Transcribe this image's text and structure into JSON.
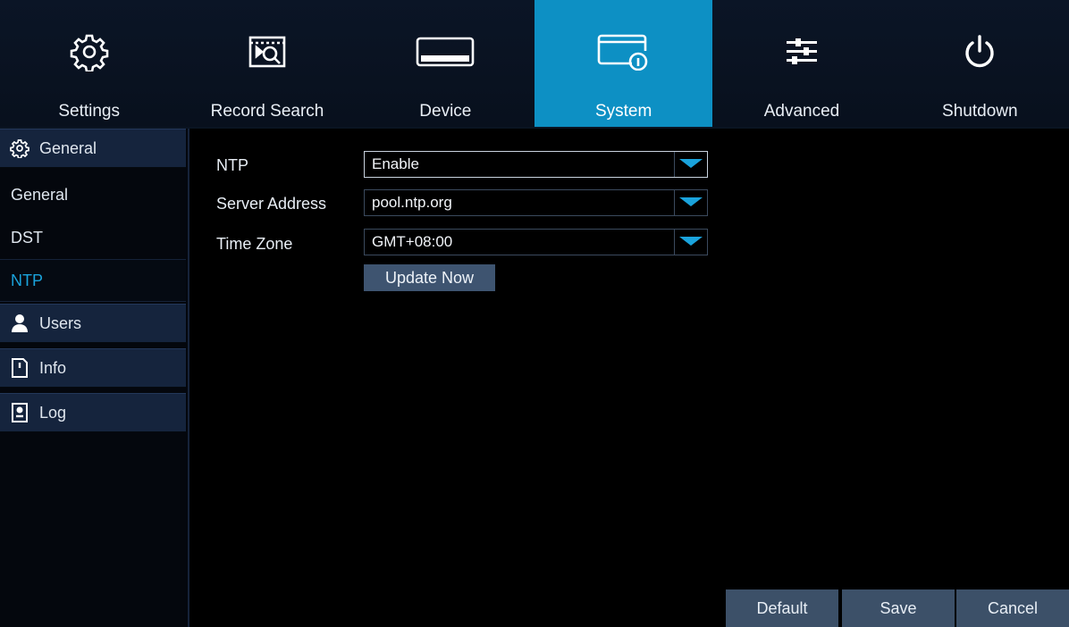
{
  "nav": {
    "tabs": [
      {
        "label": "Settings",
        "icon": "gear-icon"
      },
      {
        "label": "Record Search",
        "icon": "record-search-icon"
      },
      {
        "label": "Device",
        "icon": "hard-drive-icon"
      },
      {
        "label": "System",
        "icon": "system-info-icon"
      },
      {
        "label": "Advanced",
        "icon": "sliders-icon"
      },
      {
        "label": "Shutdown",
        "icon": "power-icon"
      }
    ],
    "active_tab": "System",
    "accent_color": "#0d90c4"
  },
  "sidebar": {
    "general_group": "General",
    "sub_items": [
      "General",
      "DST",
      "NTP"
    ],
    "active_sub": "NTP",
    "users_group": "Users",
    "info_group": "Info",
    "log_group": "Log"
  },
  "form": {
    "ntp_label": "NTP",
    "ntp_value": "Enable",
    "server_label": "Server Address",
    "server_value": "pool.ntp.org",
    "timezone_label": "Time Zone",
    "timezone_value": "GMT+08:00",
    "update_button": "Update Now"
  },
  "footer": {
    "default_button": "Default",
    "save_button": "Save",
    "cancel_button": "Cancel"
  }
}
